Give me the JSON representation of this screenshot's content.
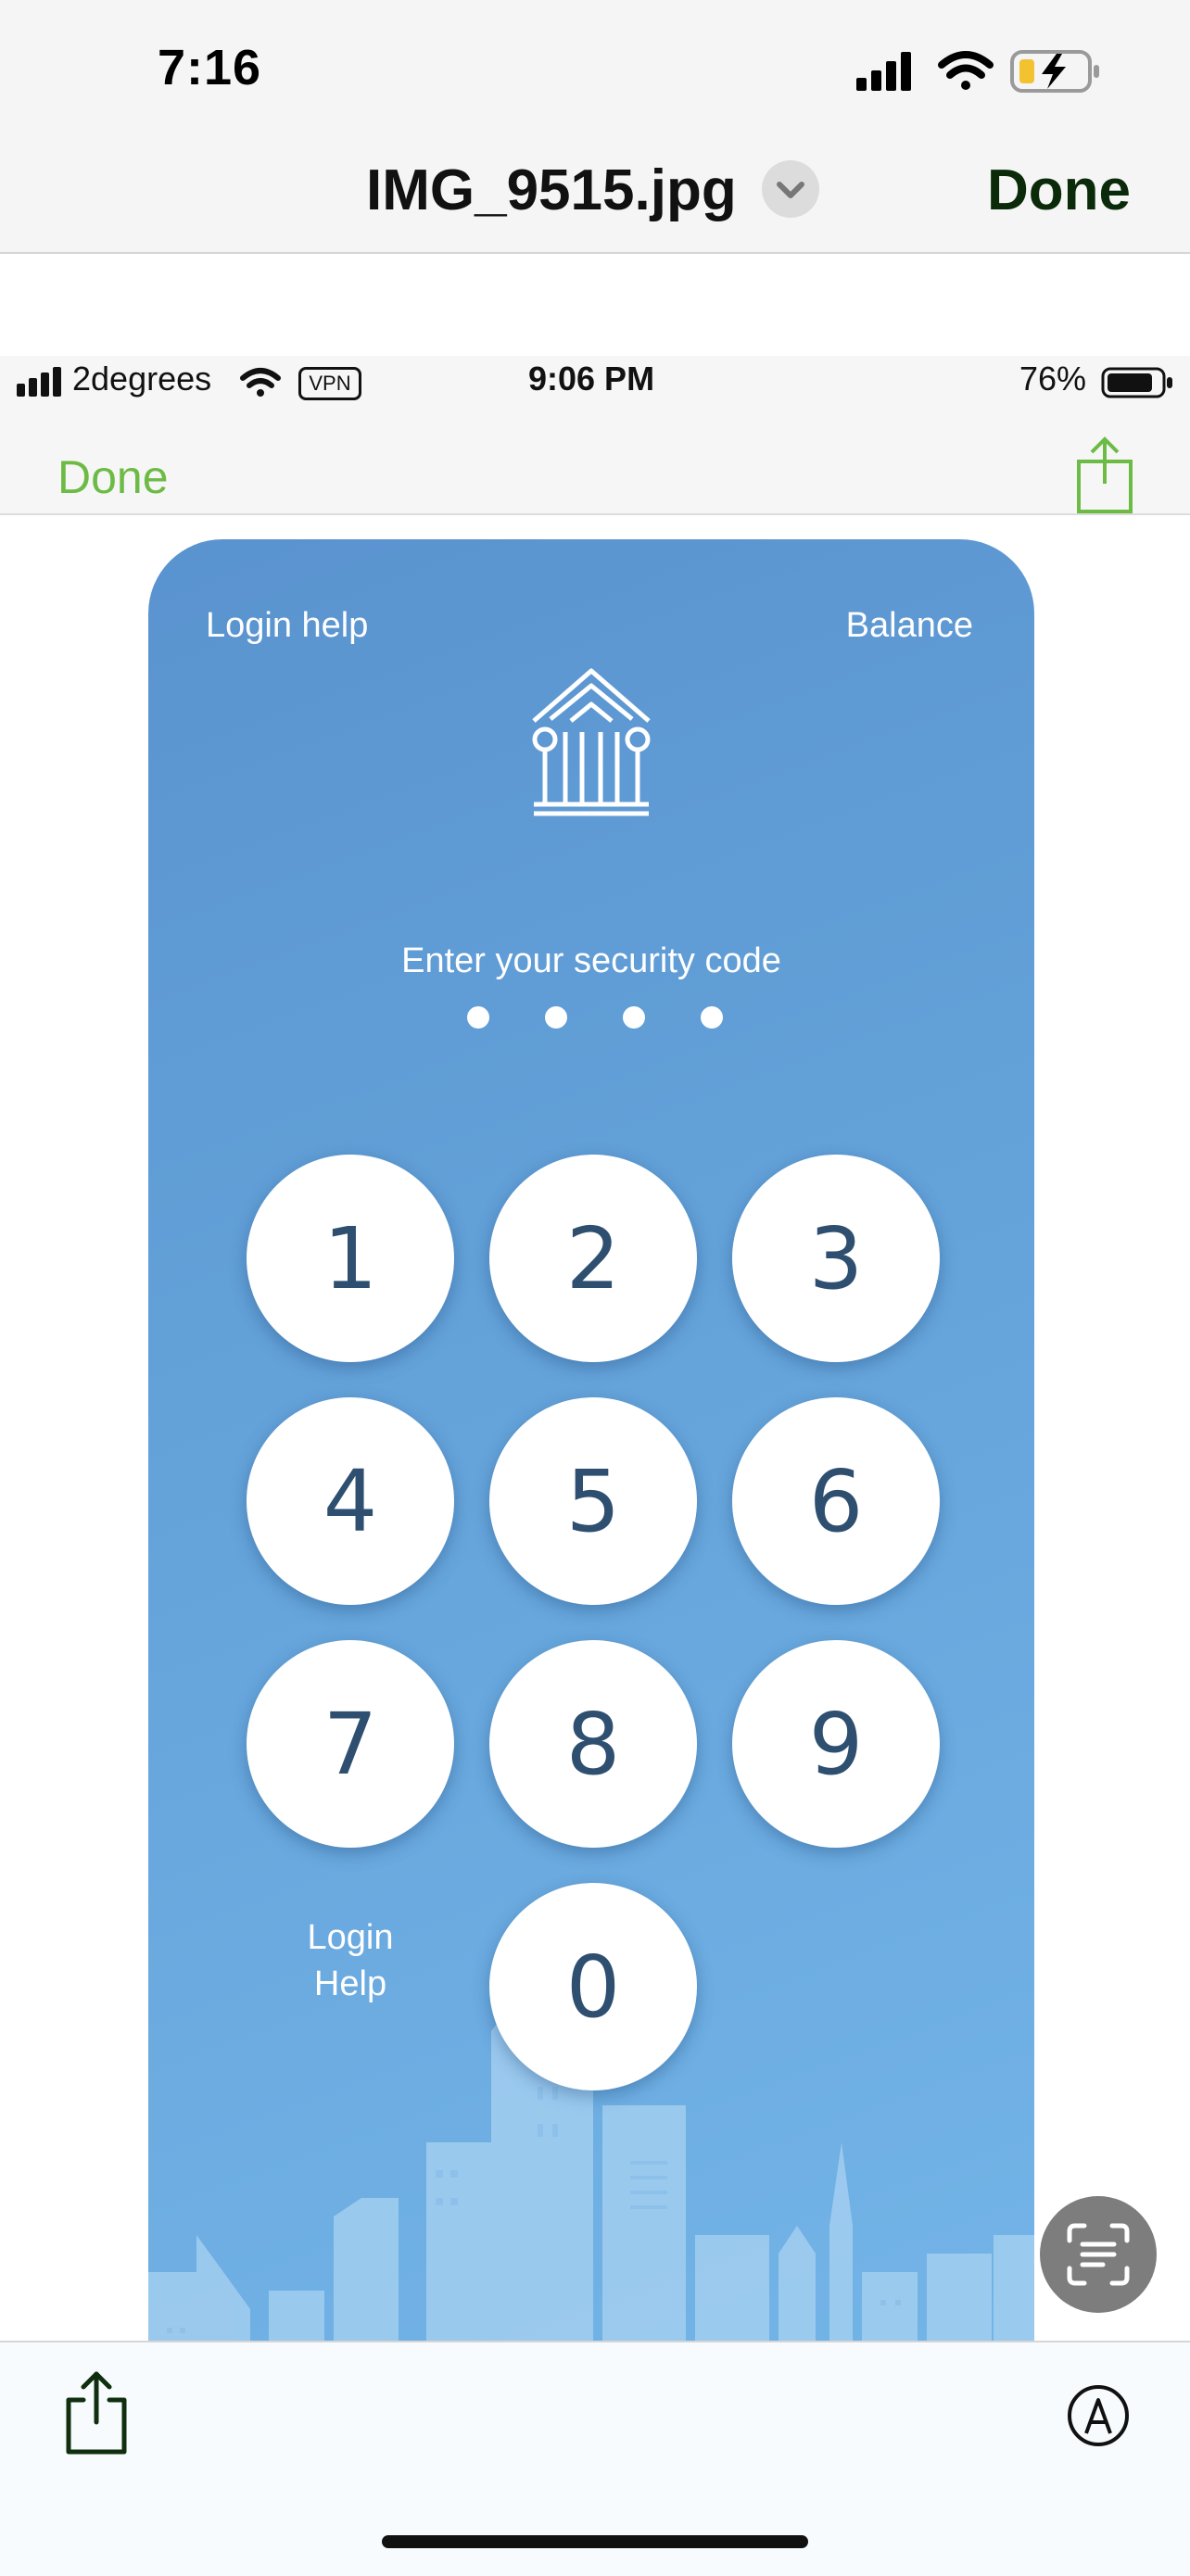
{
  "ios_status": {
    "time": "7:16"
  },
  "viewer": {
    "file_title": "IMG_9515.jpg",
    "done_label": "Done"
  },
  "screenshot": {
    "status_bar": {
      "carrier": "2degrees",
      "vpn_label": "VPN",
      "time": "9:06 PM",
      "battery_percent": "76%"
    },
    "nav": {
      "done_label": "Done"
    },
    "app": {
      "login_help_label": "Login help",
      "balance_label": "Balance",
      "prompt": "Enter your security code",
      "code_length": 4,
      "keys": [
        "1",
        "2",
        "3",
        "4",
        "5",
        "6",
        "7",
        "8",
        "9",
        "0"
      ],
      "login_help_bottom_line1": "Login",
      "login_help_bottom_line2": "Help"
    }
  },
  "colors": {
    "card_blue": "#5a93cf",
    "key_text": "#2f4f70",
    "inner_done_green": "#6cbb45"
  },
  "icons": {
    "share_outer": "share-icon",
    "markup": "markup-icon",
    "live_text": "live-text-icon",
    "bank_logo": "bank-logo-icon"
  }
}
